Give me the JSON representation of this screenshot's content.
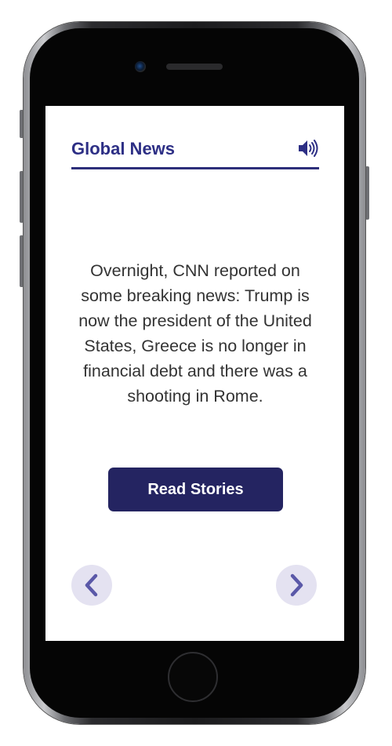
{
  "app": {
    "title": "Global News"
  },
  "header": {
    "sound_icon": "speaker-volume-icon"
  },
  "story": {
    "headline": "Overnight, CNN reported on some breaking news: Trump is now the president of the United States, Greece is no longer in financial debt and there was a shooting in Rome."
  },
  "actions": {
    "read_stories_label": "Read Stories",
    "prev_icon": "chevron-left-icon",
    "next_icon": "chevron-right-icon"
  },
  "colors": {
    "brand_navy": "#2d2f85",
    "button_navy": "#242461",
    "nav_circle": "#e4e2f1",
    "nav_chevron": "#5a58a8",
    "body_text": "#333333"
  }
}
